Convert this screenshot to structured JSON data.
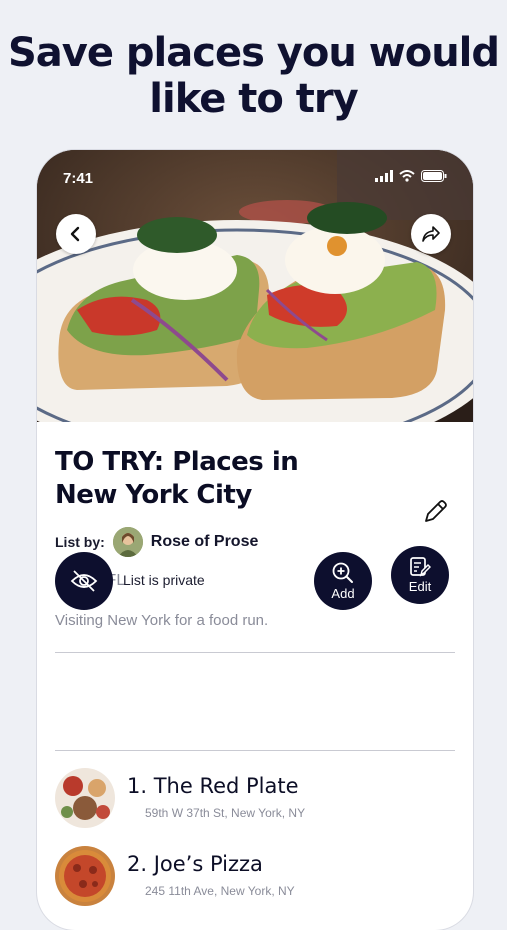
{
  "headline": {
    "line1": "Save places you would",
    "line2": "like to try"
  },
  "status_bar": {
    "time": "7:41"
  },
  "list": {
    "title_line1": "TO TRY: Places in",
    "title_line2": "New York City",
    "list_by_label": "List by:",
    "author": "Rose of Prose",
    "location": "Miami, FL",
    "description": "Visiting New York for a food run.",
    "privacy_label": "List is private",
    "add_label": "Add",
    "edit_label": "Edit"
  },
  "places": [
    {
      "name": "1. The Red Plate",
      "address": "59th W 37th St, New York, NY"
    },
    {
      "name": "2. Joe’s Pizza",
      "address": "245 11th Ave, New York, NY"
    }
  ],
  "icons": {
    "back": "chevron-left-icon",
    "share": "share-arrow-icon",
    "edit": "pencil-icon",
    "privacy": "eye-off-icon",
    "add": "magnifier-plus-icon",
    "edit_list": "edit-list-icon"
  },
  "colors": {
    "accent_dark": "#0d0f2e",
    "background": "#eef0f5",
    "muted_text": "#8a8c99"
  }
}
